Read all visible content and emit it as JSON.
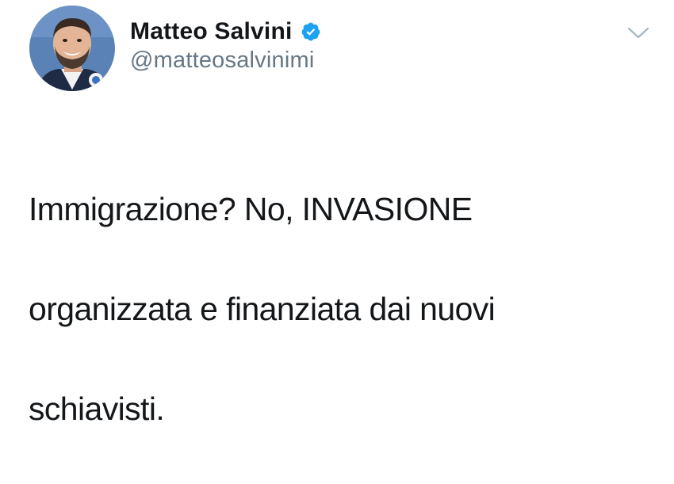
{
  "tweet": {
    "author": {
      "name": "Matteo Salvini",
      "handle": "@matteosalvinimi",
      "verified": true
    },
    "text_lines": [
      "Immigrazione? No, INVASIONE",
      "organizzata e finanziata dai nuovi",
      "schiavisti."
    ],
    "icons": {
      "verified": "verified-badge-icon",
      "menu": "chevron-down-icon"
    },
    "colors": {
      "verified_blue": "#1da1f2",
      "handle_gray": "#657786",
      "text": "#14171a"
    }
  }
}
